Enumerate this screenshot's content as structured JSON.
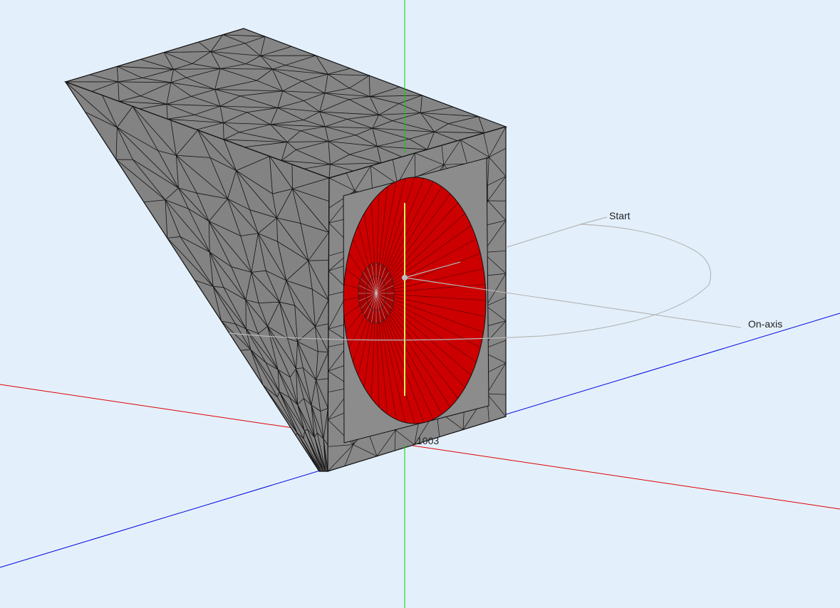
{
  "viewport": {
    "background": "#e3f0fc",
    "axes": {
      "x_color": "#e00000",
      "y_color": "#00d800",
      "z_color": "#0000e0"
    }
  },
  "labels": {
    "start": "Start",
    "on_axis": "On-axis",
    "node_id": "1003"
  },
  "model": {
    "mesh_color": "#808080",
    "driver_color": "#cc0000",
    "axis_marker_color": "#e8f060",
    "polar_path_color": "#b8b8b8"
  }
}
